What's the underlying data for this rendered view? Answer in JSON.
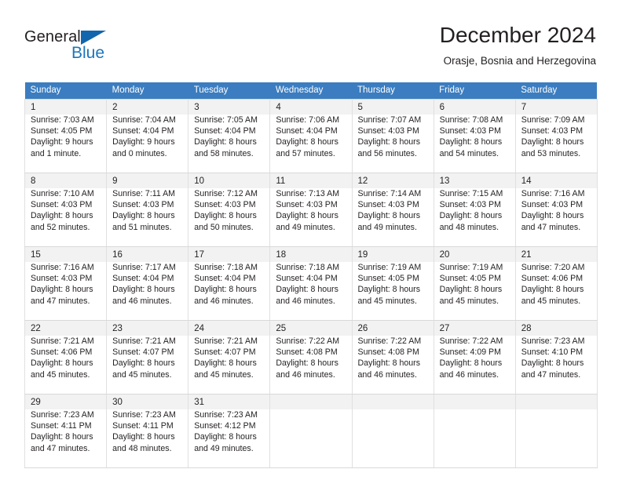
{
  "brand": {
    "name_top": "General",
    "name_bottom": "Blue",
    "triangle_icon": "brand-triangle-icon",
    "accent_color": "#1b75bb"
  },
  "header": {
    "title": "December 2024",
    "subtitle": "Orasje, Bosnia and Herzegovina"
  },
  "theme": {
    "header_bg": "#3b7dc0",
    "header_text": "#ffffff",
    "daynum_bg": "#f2f2f2",
    "cell_bg": "#ffffff",
    "border": "#e0e0e0",
    "text": "#231f20"
  },
  "calendar": {
    "weekday_headers": [
      "Sunday",
      "Monday",
      "Tuesday",
      "Wednesday",
      "Thursday",
      "Friday",
      "Saturday"
    ],
    "weeks": [
      [
        {
          "day": "1",
          "sunrise": "Sunrise: 7:03 AM",
          "sunset": "Sunset: 4:05 PM",
          "daylight_line1": "Daylight: 9 hours",
          "daylight_line2": "and 1 minute."
        },
        {
          "day": "2",
          "sunrise": "Sunrise: 7:04 AM",
          "sunset": "Sunset: 4:04 PM",
          "daylight_line1": "Daylight: 9 hours",
          "daylight_line2": "and 0 minutes."
        },
        {
          "day": "3",
          "sunrise": "Sunrise: 7:05 AM",
          "sunset": "Sunset: 4:04 PM",
          "daylight_line1": "Daylight: 8 hours",
          "daylight_line2": "and 58 minutes."
        },
        {
          "day": "4",
          "sunrise": "Sunrise: 7:06 AM",
          "sunset": "Sunset: 4:04 PM",
          "daylight_line1": "Daylight: 8 hours",
          "daylight_line2": "and 57 minutes."
        },
        {
          "day": "5",
          "sunrise": "Sunrise: 7:07 AM",
          "sunset": "Sunset: 4:03 PM",
          "daylight_line1": "Daylight: 8 hours",
          "daylight_line2": "and 56 minutes."
        },
        {
          "day": "6",
          "sunrise": "Sunrise: 7:08 AM",
          "sunset": "Sunset: 4:03 PM",
          "daylight_line1": "Daylight: 8 hours",
          "daylight_line2": "and 54 minutes."
        },
        {
          "day": "7",
          "sunrise": "Sunrise: 7:09 AM",
          "sunset": "Sunset: 4:03 PM",
          "daylight_line1": "Daylight: 8 hours",
          "daylight_line2": "and 53 minutes."
        }
      ],
      [
        {
          "day": "8",
          "sunrise": "Sunrise: 7:10 AM",
          "sunset": "Sunset: 4:03 PM",
          "daylight_line1": "Daylight: 8 hours",
          "daylight_line2": "and 52 minutes."
        },
        {
          "day": "9",
          "sunrise": "Sunrise: 7:11 AM",
          "sunset": "Sunset: 4:03 PM",
          "daylight_line1": "Daylight: 8 hours",
          "daylight_line2": "and 51 minutes."
        },
        {
          "day": "10",
          "sunrise": "Sunrise: 7:12 AM",
          "sunset": "Sunset: 4:03 PM",
          "daylight_line1": "Daylight: 8 hours",
          "daylight_line2": "and 50 minutes."
        },
        {
          "day": "11",
          "sunrise": "Sunrise: 7:13 AM",
          "sunset": "Sunset: 4:03 PM",
          "daylight_line1": "Daylight: 8 hours",
          "daylight_line2": "and 49 minutes."
        },
        {
          "day": "12",
          "sunrise": "Sunrise: 7:14 AM",
          "sunset": "Sunset: 4:03 PM",
          "daylight_line1": "Daylight: 8 hours",
          "daylight_line2": "and 49 minutes."
        },
        {
          "day": "13",
          "sunrise": "Sunrise: 7:15 AM",
          "sunset": "Sunset: 4:03 PM",
          "daylight_line1": "Daylight: 8 hours",
          "daylight_line2": "and 48 minutes."
        },
        {
          "day": "14",
          "sunrise": "Sunrise: 7:16 AM",
          "sunset": "Sunset: 4:03 PM",
          "daylight_line1": "Daylight: 8 hours",
          "daylight_line2": "and 47 minutes."
        }
      ],
      [
        {
          "day": "15",
          "sunrise": "Sunrise: 7:16 AM",
          "sunset": "Sunset: 4:03 PM",
          "daylight_line1": "Daylight: 8 hours",
          "daylight_line2": "and 47 minutes."
        },
        {
          "day": "16",
          "sunrise": "Sunrise: 7:17 AM",
          "sunset": "Sunset: 4:04 PM",
          "daylight_line1": "Daylight: 8 hours",
          "daylight_line2": "and 46 minutes."
        },
        {
          "day": "17",
          "sunrise": "Sunrise: 7:18 AM",
          "sunset": "Sunset: 4:04 PM",
          "daylight_line1": "Daylight: 8 hours",
          "daylight_line2": "and 46 minutes."
        },
        {
          "day": "18",
          "sunrise": "Sunrise: 7:18 AM",
          "sunset": "Sunset: 4:04 PM",
          "daylight_line1": "Daylight: 8 hours",
          "daylight_line2": "and 46 minutes."
        },
        {
          "day": "19",
          "sunrise": "Sunrise: 7:19 AM",
          "sunset": "Sunset: 4:05 PM",
          "daylight_line1": "Daylight: 8 hours",
          "daylight_line2": "and 45 minutes."
        },
        {
          "day": "20",
          "sunrise": "Sunrise: 7:19 AM",
          "sunset": "Sunset: 4:05 PM",
          "daylight_line1": "Daylight: 8 hours",
          "daylight_line2": "and 45 minutes."
        },
        {
          "day": "21",
          "sunrise": "Sunrise: 7:20 AM",
          "sunset": "Sunset: 4:06 PM",
          "daylight_line1": "Daylight: 8 hours",
          "daylight_line2": "and 45 minutes."
        }
      ],
      [
        {
          "day": "22",
          "sunrise": "Sunrise: 7:21 AM",
          "sunset": "Sunset: 4:06 PM",
          "daylight_line1": "Daylight: 8 hours",
          "daylight_line2": "and 45 minutes."
        },
        {
          "day": "23",
          "sunrise": "Sunrise: 7:21 AM",
          "sunset": "Sunset: 4:07 PM",
          "daylight_line1": "Daylight: 8 hours",
          "daylight_line2": "and 45 minutes."
        },
        {
          "day": "24",
          "sunrise": "Sunrise: 7:21 AM",
          "sunset": "Sunset: 4:07 PM",
          "daylight_line1": "Daylight: 8 hours",
          "daylight_line2": "and 45 minutes."
        },
        {
          "day": "25",
          "sunrise": "Sunrise: 7:22 AM",
          "sunset": "Sunset: 4:08 PM",
          "daylight_line1": "Daylight: 8 hours",
          "daylight_line2": "and 46 minutes."
        },
        {
          "day": "26",
          "sunrise": "Sunrise: 7:22 AM",
          "sunset": "Sunset: 4:08 PM",
          "daylight_line1": "Daylight: 8 hours",
          "daylight_line2": "and 46 minutes."
        },
        {
          "day": "27",
          "sunrise": "Sunrise: 7:22 AM",
          "sunset": "Sunset: 4:09 PM",
          "daylight_line1": "Daylight: 8 hours",
          "daylight_line2": "and 46 minutes."
        },
        {
          "day": "28",
          "sunrise": "Sunrise: 7:23 AM",
          "sunset": "Sunset: 4:10 PM",
          "daylight_line1": "Daylight: 8 hours",
          "daylight_line2": "and 47 minutes."
        }
      ],
      [
        {
          "day": "29",
          "sunrise": "Sunrise: 7:23 AM",
          "sunset": "Sunset: 4:11 PM",
          "daylight_line1": "Daylight: 8 hours",
          "daylight_line2": "and 47 minutes."
        },
        {
          "day": "30",
          "sunrise": "Sunrise: 7:23 AM",
          "sunset": "Sunset: 4:11 PM",
          "daylight_line1": "Daylight: 8 hours",
          "daylight_line2": "and 48 minutes."
        },
        {
          "day": "31",
          "sunrise": "Sunrise: 7:23 AM",
          "sunset": "Sunset: 4:12 PM",
          "daylight_line1": "Daylight: 8 hours",
          "daylight_line2": "and 49 minutes."
        },
        {
          "day": "",
          "sunrise": "",
          "sunset": "",
          "daylight_line1": "",
          "daylight_line2": ""
        },
        {
          "day": "",
          "sunrise": "",
          "sunset": "",
          "daylight_line1": "",
          "daylight_line2": ""
        },
        {
          "day": "",
          "sunrise": "",
          "sunset": "",
          "daylight_line1": "",
          "daylight_line2": ""
        },
        {
          "day": "",
          "sunrise": "",
          "sunset": "",
          "daylight_line1": "",
          "daylight_line2": ""
        }
      ]
    ]
  }
}
